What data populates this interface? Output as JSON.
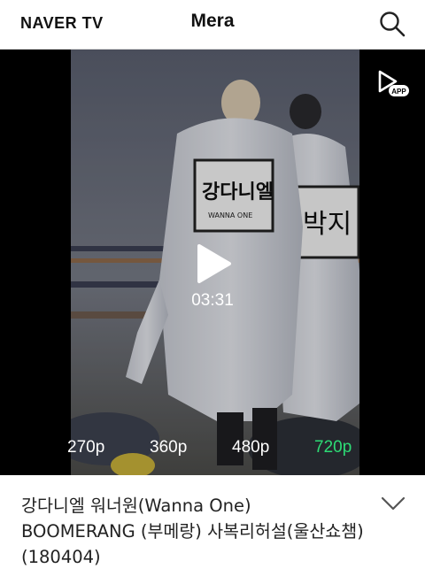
{
  "header": {
    "logo": "NAVER TV",
    "title": "Mera",
    "search_icon": "search-icon"
  },
  "player": {
    "app_badge_label": "APP",
    "duration": "03:31",
    "jersey_text_main": "강다니엘",
    "jersey_text_sub": "WANNA ONE",
    "jersey_text_side": "박지",
    "qualities": [
      {
        "label": "270p",
        "selected": false
      },
      {
        "label": "360p",
        "selected": false
      },
      {
        "label": "480p",
        "selected": false
      },
      {
        "label": "720p",
        "selected": true
      }
    ],
    "selected_quality_color": "#2ddb75"
  },
  "video": {
    "title": "강다니엘 워너원(Wanna One) BOOMERANG (부메랑) 사복리허설(울산쇼챔)(180404)"
  }
}
